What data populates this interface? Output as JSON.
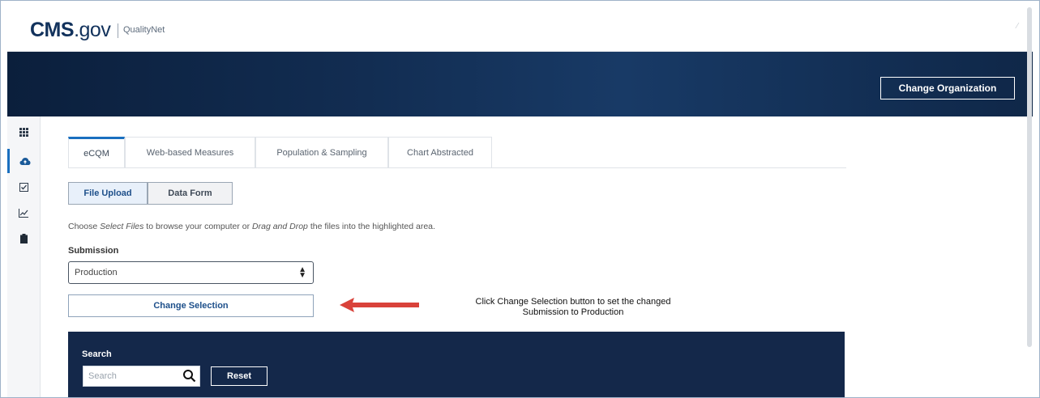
{
  "header": {
    "logo_main": "CMS",
    "logo_suffix": ".gov",
    "logo_sub": "QualityNet"
  },
  "banner": {
    "change_org_label": "Change Organization"
  },
  "rail": {
    "items": [
      {
        "icon": "grid-icon",
        "glyph": "▦"
      },
      {
        "icon": "cloud-upload-icon",
        "glyph": "☁"
      },
      {
        "icon": "checkbox-icon",
        "glyph": "☑"
      },
      {
        "icon": "chart-icon",
        "glyph": "📈"
      },
      {
        "icon": "clipboard-icon",
        "glyph": "▮"
      }
    ]
  },
  "tabs": [
    {
      "label": "eCQM",
      "active": true
    },
    {
      "label": "Web-based Measures",
      "active": false
    },
    {
      "label": "Population & Sampling",
      "active": false
    },
    {
      "label": "Chart Abstracted",
      "active": false
    }
  ],
  "toggle": {
    "file_upload": "File Upload",
    "data_form": "Data Form"
  },
  "instruction": {
    "prefix": "Choose ",
    "select_files": "Select Files",
    "middle": " to browse your computer or ",
    "drag_drop": "Drag and Drop",
    "suffix": " the files into the highlighted area."
  },
  "submission": {
    "label": "Submission",
    "selected": "Production",
    "change_selection_label": "Change Selection"
  },
  "annotation": {
    "line1": "Click Change Selection button to set the changed",
    "line2": "Submission to Production",
    "arrow_color": "#d9423a"
  },
  "search": {
    "title": "Search",
    "placeholder": "Search",
    "reset_label": "Reset"
  },
  "colors": {
    "brand_navy": "#12325c",
    "banner_dark": "#0b1f3c",
    "accent_blue": "#1a6fbf",
    "panel_navy": "#14284a"
  }
}
